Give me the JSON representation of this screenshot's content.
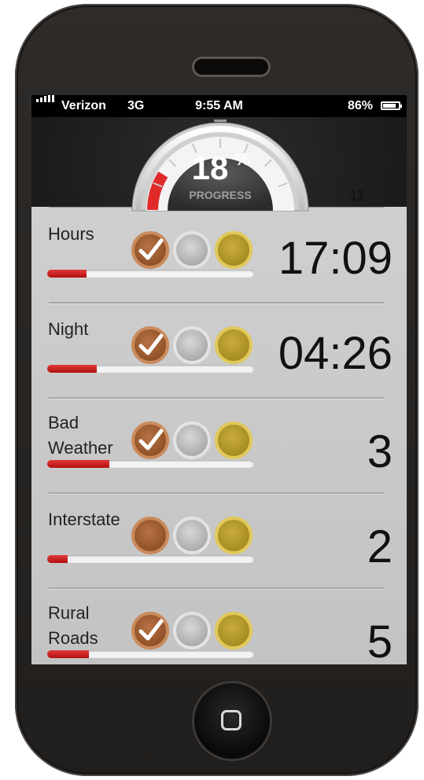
{
  "status_bar": {
    "carrier": "Verizon",
    "network": "3G",
    "time": "9:55 AM",
    "battery_percent": "86%",
    "battery_level": 0.86
  },
  "progress": {
    "value": "18",
    "unit": "%",
    "label": "PROGRESS",
    "fraction": 0.18
  },
  "header_count": "11",
  "rows": [
    {
      "label": "Hours",
      "value": "17:09",
      "progress": 0.19,
      "bronze_checked": true
    },
    {
      "label": "Night",
      "value": "04:26",
      "progress": 0.24,
      "bronze_checked": true
    },
    {
      "label": "Bad\nWeather",
      "value": "3",
      "progress": 0.3,
      "bronze_checked": true
    },
    {
      "label": "Interstate",
      "value": "2",
      "progress": 0.1,
      "bronze_checked": false
    },
    {
      "label": "Rural\nRoads",
      "value": "5",
      "progress": 0.2,
      "bronze_checked": true
    }
  ],
  "colors": {
    "accent_red": "#d32020",
    "bronze": "#9a5a2e",
    "silver": "#bdbdbf",
    "gold": "#b8982c"
  }
}
